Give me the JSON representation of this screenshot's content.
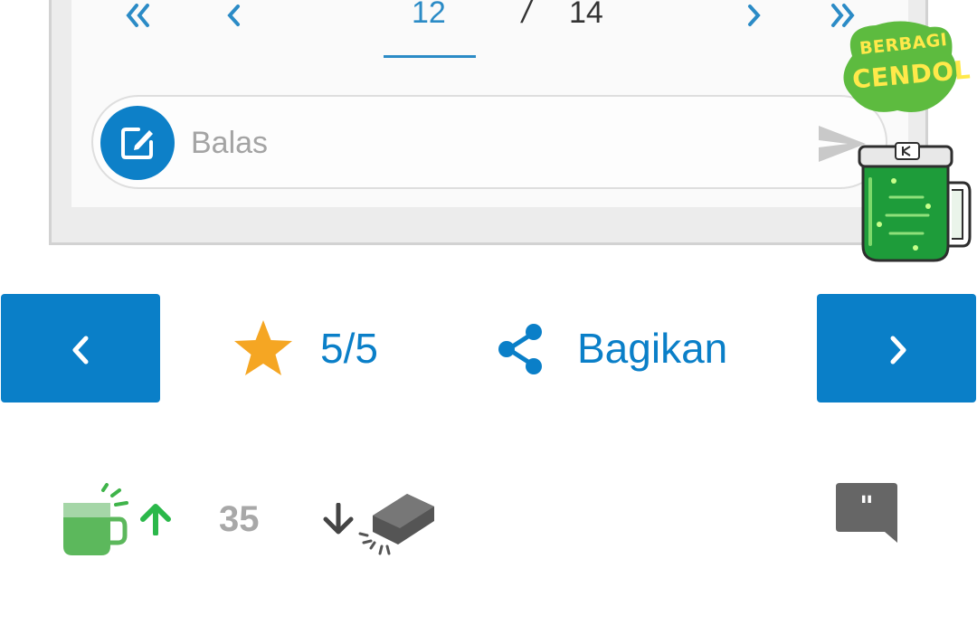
{
  "pagination": {
    "current_page": "12",
    "separator": "/",
    "total_pages": "14",
    "icons": [
      "double-chevron-left",
      "chevron-left",
      "chevron-right",
      "double-chevron-right"
    ]
  },
  "reply": {
    "placeholder": "Balas",
    "icons": [
      "edit-icon",
      "send-icon"
    ]
  },
  "promo": {
    "line1": "BERBAGI",
    "line2": "CENDOL"
  },
  "actions": {
    "rating": "5/5",
    "share_label": "Bagikan"
  },
  "votes": {
    "count": "35"
  },
  "colors": {
    "accent": "#0a7fc8",
    "star": "#f5a623",
    "cendol_green": "#4caf50",
    "muted": "#a8a8a8"
  }
}
